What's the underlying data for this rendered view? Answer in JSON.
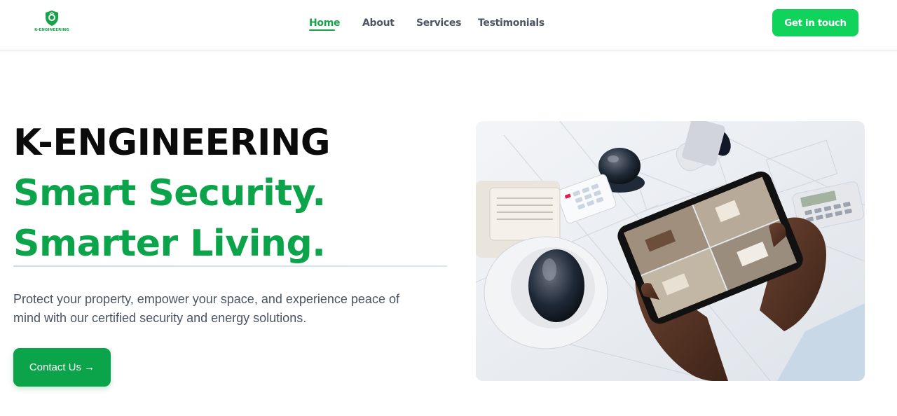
{
  "brand": {
    "logo_text": "K-ENGINEERING",
    "accent_color": "#0ca44a",
    "button_color": "#10d35c"
  },
  "nav": {
    "items": [
      {
        "label": "Home",
        "active": true
      },
      {
        "label": "About",
        "active": false
      },
      {
        "label": "Services",
        "active": false
      },
      {
        "label": "Testimonials",
        "active": false
      }
    ],
    "cta_label": "Get in touch"
  },
  "hero": {
    "title": "K-ENGINEERING",
    "tagline_line1": "Smart Security.",
    "tagline_line2": "Smarter Living.",
    "description": "Protect your property, empower your space, and experience peace of mind with our certified security and energy solutions.",
    "cta_label": "Contact Us →"
  },
  "icons": [
    "shield-logo-icon",
    "arrow-right-icon"
  ]
}
